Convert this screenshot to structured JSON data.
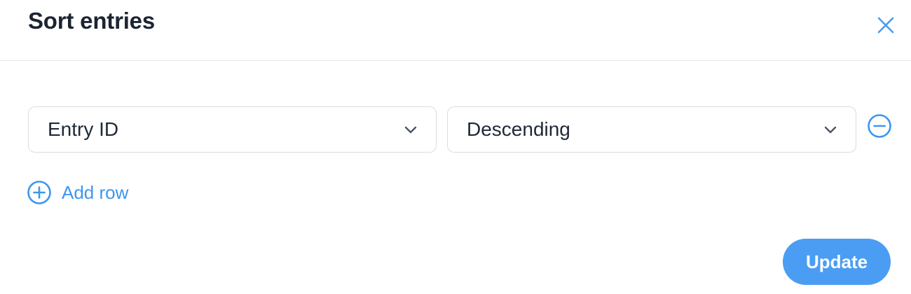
{
  "dialog": {
    "title": "Sort entries",
    "close_icon": "close-icon"
  },
  "sort_rows": [
    {
      "field": "Entry ID",
      "direction": "Descending"
    }
  ],
  "add_row": {
    "label": "Add row",
    "icon": "plus-circle-icon"
  },
  "actions": {
    "update_label": "Update"
  },
  "colors": {
    "accent": "#3d96f0",
    "button": "#4a9df2",
    "text": "#1f2937",
    "border": "#d9dde3"
  }
}
